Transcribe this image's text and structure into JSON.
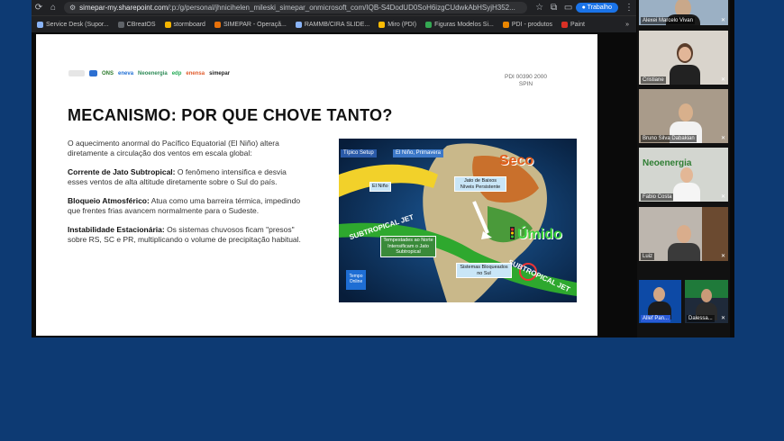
{
  "browser": {
    "url_host": "simepar-my.sharepoint.com",
    "url_path": "/:p:/g/personal/jhnicihelen_mileski_simepar_onmicrosoft_com/IQB-S4DodUD0SoH6izgCUdwkAbHSyjH352...",
    "profile_label": "Trabalho"
  },
  "bookmarks": [
    {
      "label": "Service Desk (Supor..."
    },
    {
      "label": "CBreatOS"
    },
    {
      "label": "stormboard"
    },
    {
      "label": "SIMEPAR - Operaçã..."
    },
    {
      "label": "RAMMB/CIRA SLIDE..."
    },
    {
      "label": "Miro (PDI)"
    },
    {
      "label": "Figuras Modelos Si..."
    },
    {
      "label": "PDI - produtos"
    },
    {
      "label": "Paint"
    }
  ],
  "slide": {
    "logos": [
      "ONS",
      "eneva",
      "Neoenergia",
      "edp",
      "enensa",
      "simepar"
    ],
    "pdi_code": "PDI 00390 2000",
    "pdi_spin": "SPIN",
    "title": "MECANISMO: POR QUE CHOVE TANTO?",
    "intro": "O aquecimento anormal do Pacífico Equatorial (El Niño) altera diretamente a circulação dos ventos em escala global:",
    "points": [
      {
        "heading": "Corrente de Jato Subtropical:",
        "text": " O fenômeno intensifica e desvia esses ventos de alta altitude diretamente sobre o Sul do país."
      },
      {
        "heading": "Bloqueio Atmosférico:",
        "text": " Atua como uma barreira térmica, impedindo que frentes frias avancem normalmente para o Sudeste."
      },
      {
        "heading": "Instabilidade Estacionária:",
        "text": " Os sistemas chuvosos ficam \"presos\" sobre RS, SC e PR, multiplicando o volume de precipitação habitual."
      }
    ],
    "map": {
      "tab1": "Típico Setup",
      "tab2": "El Niño, Primavera",
      "seco": "Seco",
      "umido": "Úmido",
      "el_nino": "El Niño",
      "jato_baixos": "Jato de Baixos Níveis Persistente",
      "tempestades": "Tempestades ao Norte Intensificam o Jato Subtropical",
      "sistemas": "Sistemas Bloqueados no Sul",
      "jet_left": "SUBTROPICAL JET",
      "jet_right": "SUBTROPICAL JET",
      "brand": "Tempo Online"
    }
  },
  "participants": [
    {
      "name": "Alexei Marcelo Vivan"
    },
    {
      "name": "Cristiane"
    },
    {
      "name": "Bruno Silva Dabakian"
    },
    {
      "name": "Fabio Costa",
      "logo": "Neoenergia"
    },
    {
      "name": "Luiz"
    },
    {
      "name": "Allef Pan..."
    },
    {
      "name": "Dalessa..."
    }
  ]
}
